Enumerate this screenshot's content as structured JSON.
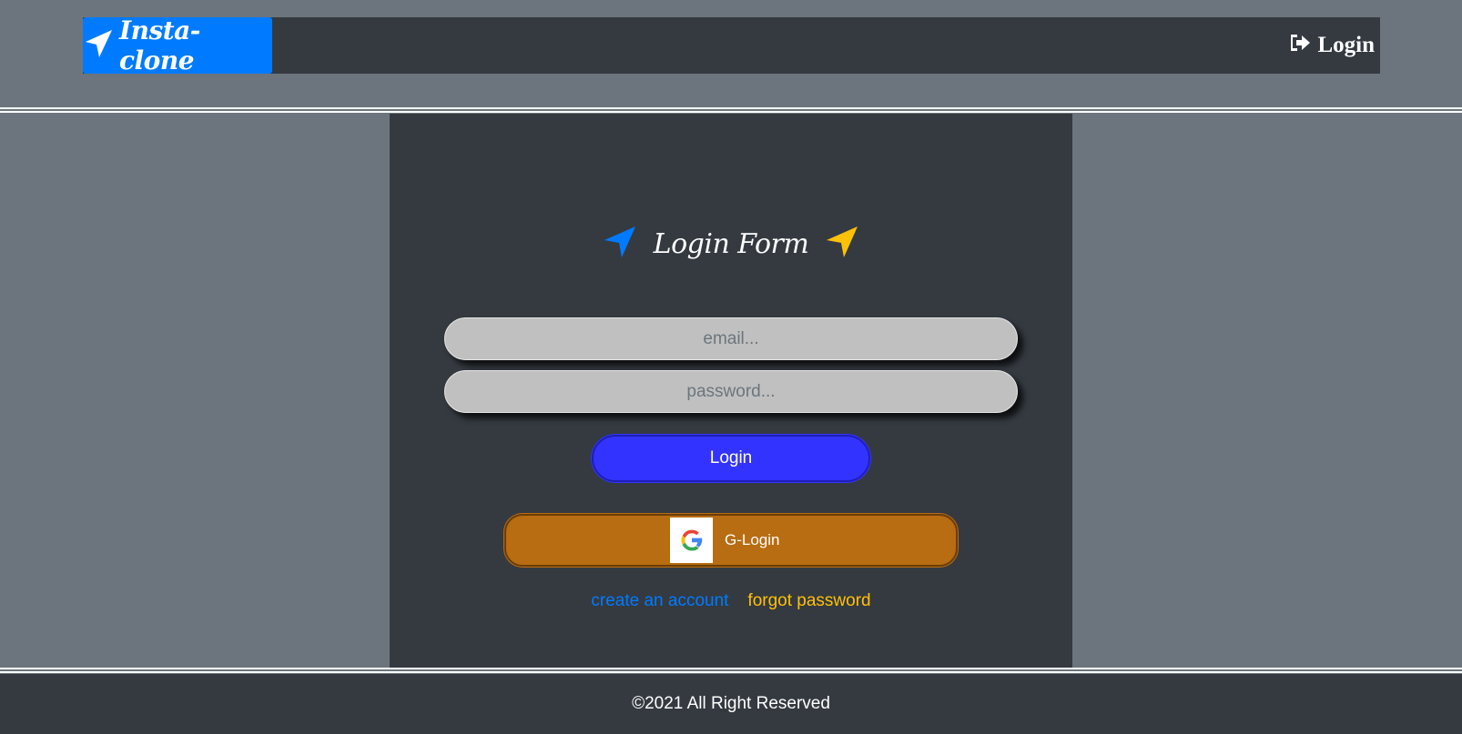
{
  "navbar": {
    "brand": "Insta-clone",
    "brand_icon": "paper-plane-icon",
    "login_label": "Login",
    "login_icon": "sign-out-icon"
  },
  "form": {
    "title": "Login Form",
    "title_icon_left": "location-arrow-icon",
    "title_icon_right": "location-arrow-icon",
    "email_placeholder": "email...",
    "password_placeholder": "password...",
    "login_button": "Login",
    "google_button": "G-Login",
    "google_icon": "google-logo-icon",
    "create_account_link": "create an account",
    "forgot_password_link": "forgot password"
  },
  "footer": {
    "text": "©2021 All Right Reserved"
  },
  "colors": {
    "page_bg": "#6c757d",
    "panel_bg": "#343a40",
    "brand_blue": "#007bff",
    "login_button": "#3333ff",
    "google_button": "#b86d12",
    "warning_yellow": "#ffc107",
    "input_bg": "#c0c0c0"
  }
}
